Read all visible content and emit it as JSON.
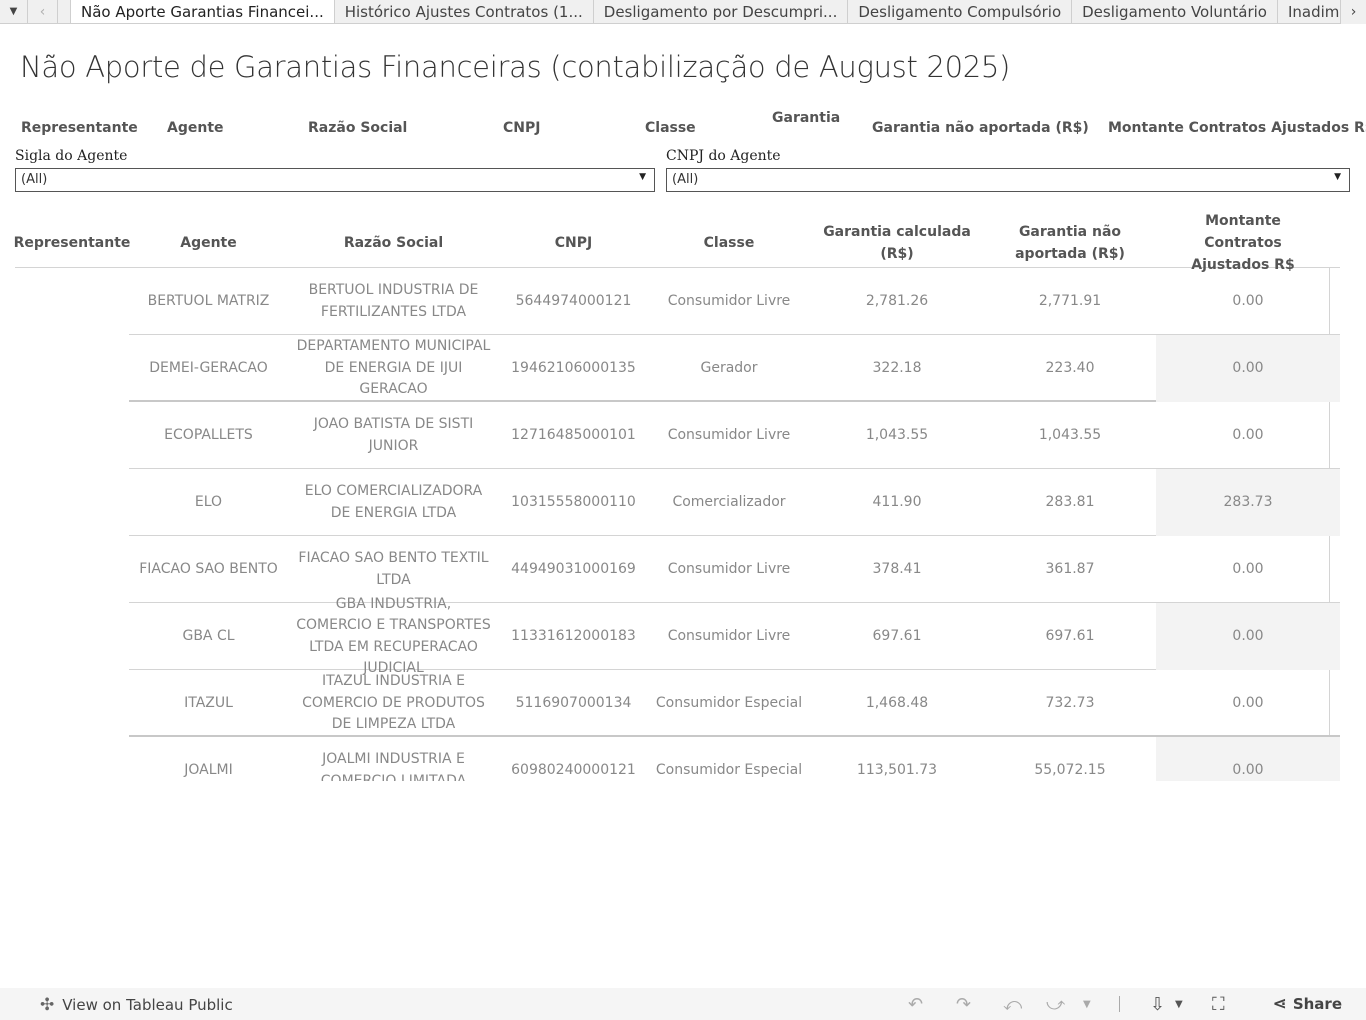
{
  "tabs": [
    "Não Aporte Garantias Financei...",
    "Histórico Ajustes Contratos (1...",
    "Desligamento por Descumpri...",
    "Desligamento Compulsório",
    "Desligamento Voluntário",
    "Inadim"
  ],
  "title": "Não Aporte de Garantias Financeiras (contabilização de August 2025)",
  "floating_header": {
    "representante": "Representante",
    "agente": "Agente",
    "razao_social": "Razão Social",
    "cnpj": "CNPJ",
    "classe": "Classe",
    "garantia_calculada": "Garantia",
    "garantia_nao_aportada": "Garantia não aportada (R$)",
    "montante": "Montante Contratos Ajustados R$"
  },
  "filters": {
    "sigla": {
      "label": "Sigla do Agente",
      "value": "(All)"
    },
    "cnpj": {
      "label": "CNPJ do Agente",
      "value": "(All)"
    }
  },
  "table": {
    "headers": {
      "representante": "Representante",
      "agente": "Agente",
      "razao_social": "Razão Social",
      "cnpj": "CNPJ",
      "classe": "Classe",
      "garantia_calculada": "Garantia calculada (R$)",
      "garantia_nao_aportada": "Garantia não aportada (R$)",
      "montante": "Montante Contratos Ajustados R$"
    },
    "rows": [
      {
        "agente": "BERTUOL MATRIZ",
        "razao": "BERTUOL INDUSTRIA DE FERTILIZANTES LTDA",
        "cnpj": "5644974000121",
        "classe": "Consumidor Livre",
        "calc": "2,781.26",
        "nao": "2,771.91",
        "montante": "0.00"
      },
      {
        "agente": "DEMEI-GERACAO",
        "razao": "DEPARTAMENTO MUNICIPAL DE ENERGIA DE IJUI GERACAO",
        "cnpj": "19462106000135",
        "classe": "Gerador",
        "calc": "322.18",
        "nao": "223.40",
        "montante": "0.00"
      },
      {
        "agente": "ECOPALLETS",
        "razao": "JOAO BATISTA DE SISTI JUNIOR",
        "cnpj": "12716485000101",
        "classe": "Consumidor Livre",
        "calc": "1,043.55",
        "nao": "1,043.55",
        "montante": "0.00"
      },
      {
        "agente": "ELO",
        "razao": "ELO COMERCIALIZADORA DE ENERGIA LTDA",
        "cnpj": "10315558000110",
        "classe": "Comercializador",
        "calc": "411.90",
        "nao": "283.81",
        "montante": "283.73"
      },
      {
        "agente": "FIACAO SAO BENTO",
        "razao": "FIACAO SAO BENTO TEXTIL LTDA",
        "cnpj": "44949031000169",
        "classe": "Consumidor Livre",
        "calc": "378.41",
        "nao": "361.87",
        "montante": "0.00"
      },
      {
        "agente": "GBA CL",
        "razao": "GBA INDUSTRIA, COMERCIO E TRANSPORTES LTDA EM RECUPERACAO JUDICIAL",
        "cnpj": "11331612000183",
        "classe": "Consumidor Livre",
        "calc": "697.61",
        "nao": "697.61",
        "montante": "0.00"
      },
      {
        "agente": "ITAZUL",
        "razao": "ITAZUL INDUSTRIA E COMERCIO DE PRODUTOS DE LIMPEZA LTDA",
        "cnpj": "5116907000134",
        "classe": "Consumidor Especial",
        "calc": "1,468.48",
        "nao": "732.73",
        "montante": "0.00"
      },
      {
        "agente": "JOALMI",
        "razao": "JOALMI INDUSTRIA E COMERCIO LIMITADA",
        "cnpj": "60980240000121",
        "classe": "Consumidor Especial",
        "calc": "113,501.73",
        "nao": "55,072.15",
        "montante": "0.00"
      }
    ]
  },
  "footer": {
    "view_label": "View on Tableau Public",
    "share_label": "Share"
  }
}
